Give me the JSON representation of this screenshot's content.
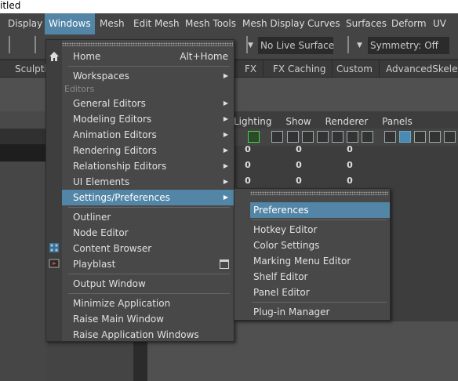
{
  "window": {
    "title": "itled"
  },
  "menubar": {
    "items": [
      "Display",
      "Windows",
      "Mesh",
      "Edit Mesh",
      "Mesh Tools",
      "Mesh Display",
      "Curves",
      "Surfaces",
      "Deform",
      "UV"
    ],
    "active": "Windows"
  },
  "statusline": {
    "live_surface": "No Live Surface",
    "symmetry": "Symmetry: Off"
  },
  "shelf_tabs": [
    "Sculptin",
    "FX",
    "FX Caching",
    "Custom",
    "AdvancedSkeleton"
  ],
  "viewport": {
    "menu": [
      "Lighting",
      "Show",
      "Renderer",
      "Panels"
    ],
    "hud_values": [
      "0",
      "0",
      "0",
      "0",
      "0",
      "0",
      "0",
      "0",
      "0"
    ]
  },
  "windows_menu": {
    "home": {
      "label": "Home",
      "shortcut": "Alt+Home"
    },
    "workspaces": "Workspaces",
    "editors_section": "Editors",
    "editors": [
      "General Editors",
      "Modeling Editors",
      "Animation Editors",
      "Rendering Editors",
      "Relationship Editors",
      "UI Elements",
      "Settings/Preferences"
    ],
    "panels": [
      "Outliner",
      "Node Editor",
      "Content Browser",
      "Playblast"
    ],
    "output_window": "Output Window",
    "window_actions": [
      "Minimize Application",
      "Raise Main Window",
      "Raise Application Windows"
    ]
  },
  "settings_submenu": {
    "items": [
      "Preferences",
      "Hotkey Editor",
      "Color Settings",
      "Marking Menu Editor",
      "Shelf Editor",
      "Panel Editor",
      "Plug-in Manager"
    ]
  },
  "colors": {
    "highlight": "#5285a6",
    "menu_bg": "#484848",
    "app_bg": "#444444"
  }
}
